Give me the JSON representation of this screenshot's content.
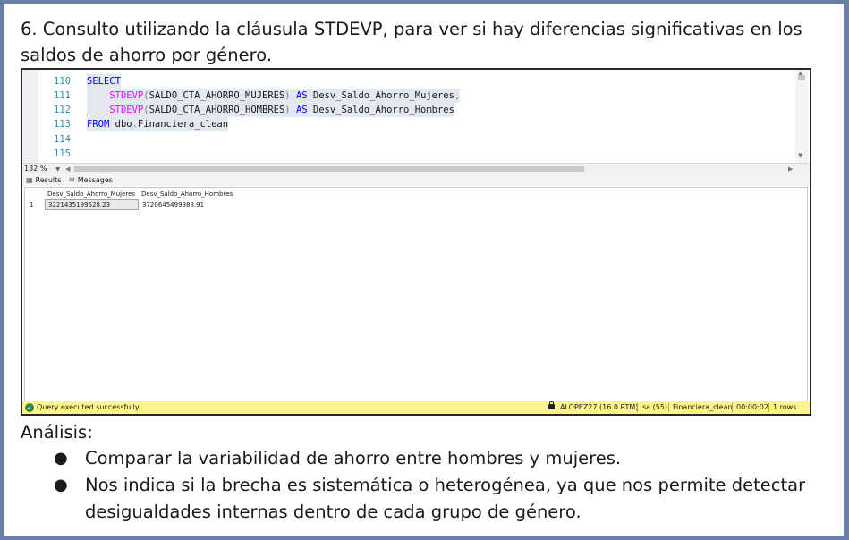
{
  "heading": "6. Consulto utilizando la cláusula STDEVP, para ver si hay diferencias significativas en los saldos de ahorro por género.",
  "editor": {
    "lines": [
      {
        "num": "110",
        "parts": [
          {
            "t": "SELECT",
            "c": "kw"
          }
        ]
      },
      {
        "num": "111",
        "parts": [
          {
            "t": "    ",
            "c": ""
          },
          {
            "t": "STDEVP",
            "c": "fn"
          },
          {
            "t": "(",
            "c": "gr"
          },
          {
            "t": "SALDO_CTA_AHORRO_MUJERES",
            "c": ""
          },
          {
            "t": ")",
            "c": "gr"
          },
          {
            "t": " ",
            "c": ""
          },
          {
            "t": "AS",
            "c": "kw"
          },
          {
            "t": " Desv_Saldo_Ahorro_Mujeres",
            "c": ""
          },
          {
            "t": ",",
            "c": "gr"
          }
        ]
      },
      {
        "num": "112",
        "parts": [
          {
            "t": "    ",
            "c": ""
          },
          {
            "t": "STDEVP",
            "c": "fn"
          },
          {
            "t": "(",
            "c": "gr"
          },
          {
            "t": "SALDO_CTA_AHORRO_HOMBRES",
            "c": ""
          },
          {
            "t": ")",
            "c": "gr"
          },
          {
            "t": " ",
            "c": ""
          },
          {
            "t": "AS",
            "c": "kw"
          },
          {
            "t": " Desv_Saldo_Ahorro_Hombres",
            "c": ""
          }
        ]
      },
      {
        "num": "113",
        "parts": [
          {
            "t": "FROM",
            "c": "kw"
          },
          {
            "t": " dbo",
            "c": ""
          },
          {
            "t": ".",
            "c": "gr"
          },
          {
            "t": "Financiera_clean",
            "c": ""
          }
        ]
      },
      {
        "num": "114",
        "parts": []
      },
      {
        "num": "115",
        "parts": []
      }
    ]
  },
  "zoom": "132 %",
  "tabs": {
    "results": "Results",
    "messages": "Messages"
  },
  "grid": {
    "columns": [
      "Desv_Saldo_Ahorro_Mujeres",
      "Desv_Saldo_Ahorro_Hombres"
    ],
    "rows": [
      {
        "num": "1",
        "values": [
          "3221435199628,23",
          "3720645499988,91"
        ]
      }
    ]
  },
  "status": {
    "message": "Query executed successfully.",
    "server": "ALOPEZ27 (16.0 RTM)",
    "user": "sa (55)",
    "database": "Financiera_clean",
    "elapsed": "00:00:02",
    "rows": "1 rows"
  },
  "analysis": {
    "title": "Análisis:",
    "bullets": [
      "Comparar la variabilidad de ahorro entre hombres y mujeres.",
      "Nos indica si la brecha es sistemática o heterogénea, ya que nos permite detectar desigualdades internas dentro de cada grupo de género."
    ]
  }
}
